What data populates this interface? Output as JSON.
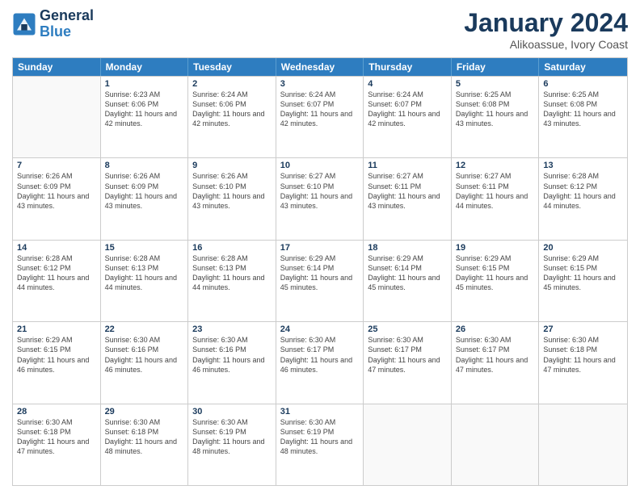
{
  "logo": {
    "line1": "General",
    "line2": "Blue"
  },
  "header": {
    "month": "January 2024",
    "location": "Alikoassue, Ivory Coast"
  },
  "days_of_week": [
    "Sunday",
    "Monday",
    "Tuesday",
    "Wednesday",
    "Thursday",
    "Friday",
    "Saturday"
  ],
  "weeks": [
    [
      {
        "day": "",
        "empty": true
      },
      {
        "day": "1",
        "sunrise": "6:23 AM",
        "sunset": "6:06 PM",
        "daylight": "11 hours and 42 minutes."
      },
      {
        "day": "2",
        "sunrise": "6:24 AM",
        "sunset": "6:06 PM",
        "daylight": "11 hours and 42 minutes."
      },
      {
        "day": "3",
        "sunrise": "6:24 AM",
        "sunset": "6:07 PM",
        "daylight": "11 hours and 42 minutes."
      },
      {
        "day": "4",
        "sunrise": "6:24 AM",
        "sunset": "6:07 PM",
        "daylight": "11 hours and 42 minutes."
      },
      {
        "day": "5",
        "sunrise": "6:25 AM",
        "sunset": "6:08 PM",
        "daylight": "11 hours and 43 minutes."
      },
      {
        "day": "6",
        "sunrise": "6:25 AM",
        "sunset": "6:08 PM",
        "daylight": "11 hours and 43 minutes."
      }
    ],
    [
      {
        "day": "7",
        "sunrise": "6:26 AM",
        "sunset": "6:09 PM",
        "daylight": "11 hours and 43 minutes."
      },
      {
        "day": "8",
        "sunrise": "6:26 AM",
        "sunset": "6:09 PM",
        "daylight": "11 hours and 43 minutes."
      },
      {
        "day": "9",
        "sunrise": "6:26 AM",
        "sunset": "6:10 PM",
        "daylight": "11 hours and 43 minutes."
      },
      {
        "day": "10",
        "sunrise": "6:27 AM",
        "sunset": "6:10 PM",
        "daylight": "11 hours and 43 minutes."
      },
      {
        "day": "11",
        "sunrise": "6:27 AM",
        "sunset": "6:11 PM",
        "daylight": "11 hours and 43 minutes."
      },
      {
        "day": "12",
        "sunrise": "6:27 AM",
        "sunset": "6:11 PM",
        "daylight": "11 hours and 44 minutes."
      },
      {
        "day": "13",
        "sunrise": "6:28 AM",
        "sunset": "6:12 PM",
        "daylight": "11 hours and 44 minutes."
      }
    ],
    [
      {
        "day": "14",
        "sunrise": "6:28 AM",
        "sunset": "6:12 PM",
        "daylight": "11 hours and 44 minutes."
      },
      {
        "day": "15",
        "sunrise": "6:28 AM",
        "sunset": "6:13 PM",
        "daylight": "11 hours and 44 minutes."
      },
      {
        "day": "16",
        "sunrise": "6:28 AM",
        "sunset": "6:13 PM",
        "daylight": "11 hours and 44 minutes."
      },
      {
        "day": "17",
        "sunrise": "6:29 AM",
        "sunset": "6:14 PM",
        "daylight": "11 hours and 45 minutes."
      },
      {
        "day": "18",
        "sunrise": "6:29 AM",
        "sunset": "6:14 PM",
        "daylight": "11 hours and 45 minutes."
      },
      {
        "day": "19",
        "sunrise": "6:29 AM",
        "sunset": "6:15 PM",
        "daylight": "11 hours and 45 minutes."
      },
      {
        "day": "20",
        "sunrise": "6:29 AM",
        "sunset": "6:15 PM",
        "daylight": "11 hours and 45 minutes."
      }
    ],
    [
      {
        "day": "21",
        "sunrise": "6:29 AM",
        "sunset": "6:15 PM",
        "daylight": "11 hours and 46 minutes."
      },
      {
        "day": "22",
        "sunrise": "6:30 AM",
        "sunset": "6:16 PM",
        "daylight": "11 hours and 46 minutes."
      },
      {
        "day": "23",
        "sunrise": "6:30 AM",
        "sunset": "6:16 PM",
        "daylight": "11 hours and 46 minutes."
      },
      {
        "day": "24",
        "sunrise": "6:30 AM",
        "sunset": "6:17 PM",
        "daylight": "11 hours and 46 minutes."
      },
      {
        "day": "25",
        "sunrise": "6:30 AM",
        "sunset": "6:17 PM",
        "daylight": "11 hours and 47 minutes."
      },
      {
        "day": "26",
        "sunrise": "6:30 AM",
        "sunset": "6:17 PM",
        "daylight": "11 hours and 47 minutes."
      },
      {
        "day": "27",
        "sunrise": "6:30 AM",
        "sunset": "6:18 PM",
        "daylight": "11 hours and 47 minutes."
      }
    ],
    [
      {
        "day": "28",
        "sunrise": "6:30 AM",
        "sunset": "6:18 PM",
        "daylight": "11 hours and 47 minutes."
      },
      {
        "day": "29",
        "sunrise": "6:30 AM",
        "sunset": "6:18 PM",
        "daylight": "11 hours and 48 minutes."
      },
      {
        "day": "30",
        "sunrise": "6:30 AM",
        "sunset": "6:19 PM",
        "daylight": "11 hours and 48 minutes."
      },
      {
        "day": "31",
        "sunrise": "6:30 AM",
        "sunset": "6:19 PM",
        "daylight": "11 hours and 48 minutes."
      },
      {
        "day": "",
        "empty": true
      },
      {
        "day": "",
        "empty": true
      },
      {
        "day": "",
        "empty": true
      }
    ]
  ]
}
